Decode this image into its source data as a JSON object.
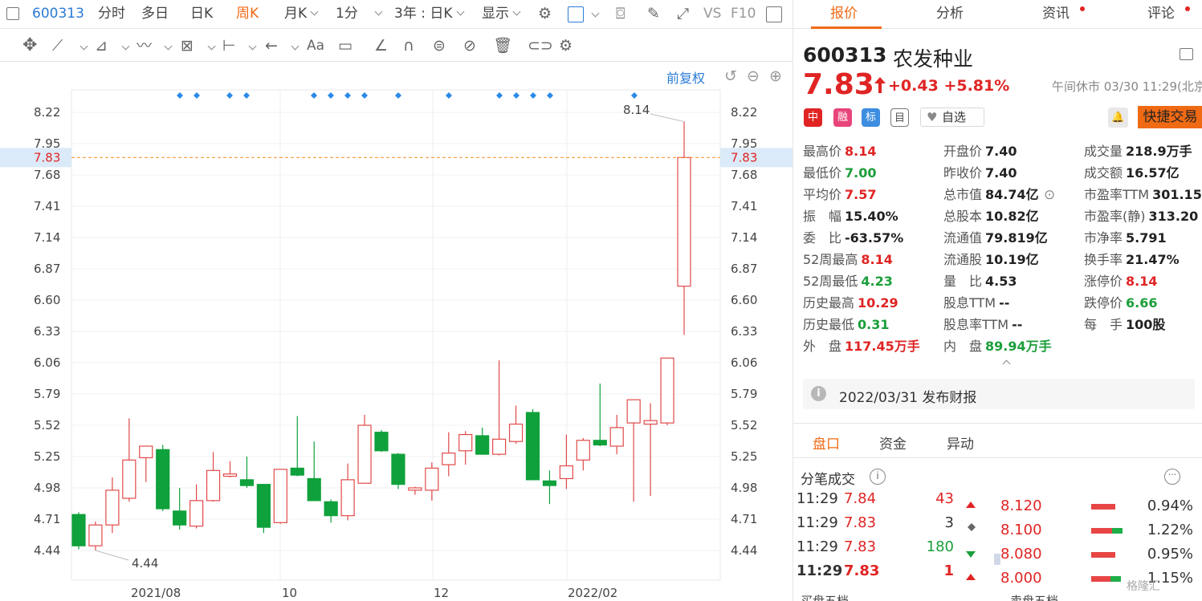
{
  "toolbar": {
    "code": "600313",
    "items": [
      "分时",
      "多日",
      "日K",
      "周K",
      "月K",
      "1分",
      "3年 : 日K",
      "显示"
    ],
    "active": "周K",
    "vs": "VS",
    "f10": "F10"
  },
  "chart": {
    "adjust": "前复权",
    "price_line_label": "7.83",
    "max_label": "8.14",
    "min_label": "4.44"
  },
  "chart_data": {
    "type": "candlestick",
    "y_ticks": [
      "8.22",
      "7.95",
      "7.68",
      "7.41",
      "7.14",
      "6.87",
      "6.60",
      "6.33",
      "6.06",
      "5.79",
      "5.52",
      "5.25",
      "4.98",
      "4.71",
      "4.44"
    ],
    "y_range": [
      4.44,
      8.22
    ],
    "x_labels": [
      "2021/08",
      "10",
      "12",
      "2022/02"
    ],
    "current_price": 7.83,
    "candles": [
      {
        "o": 4.75,
        "h": 4.77,
        "l": 4.45,
        "c": 4.48
      },
      {
        "o": 4.48,
        "h": 4.69,
        "l": 4.44,
        "c": 4.66
      },
      {
        "o": 4.66,
        "h": 5.07,
        "l": 4.59,
        "c": 4.96
      },
      {
        "o": 4.89,
        "h": 5.58,
        "l": 4.86,
        "c": 5.22
      },
      {
        "o": 5.24,
        "h": 5.34,
        "l": 5.03,
        "c": 5.34
      },
      {
        "o": 5.31,
        "h": 5.35,
        "l": 4.78,
        "c": 4.8
      },
      {
        "o": 4.78,
        "h": 4.98,
        "l": 4.62,
        "c": 4.66
      },
      {
        "o": 4.65,
        "h": 5.01,
        "l": 4.63,
        "c": 4.87
      },
      {
        "o": 4.87,
        "h": 5.29,
        "l": 4.86,
        "c": 5.13
      },
      {
        "o": 5.08,
        "h": 5.21,
        "l": 5.07,
        "c": 5.1
      },
      {
        "o": 5.05,
        "h": 5.25,
        "l": 4.98,
        "c": 5.0
      },
      {
        "o": 5.01,
        "h": 5.01,
        "l": 4.59,
        "c": 4.64
      },
      {
        "o": 4.68,
        "h": 5.14,
        "l": 4.67,
        "c": 5.14
      },
      {
        "o": 5.15,
        "h": 5.6,
        "l": 5.08,
        "c": 5.09
      },
      {
        "o": 5.06,
        "h": 5.38,
        "l": 4.87,
        "c": 4.87
      },
      {
        "o": 4.86,
        "h": 4.88,
        "l": 4.68,
        "c": 4.74
      },
      {
        "o": 4.74,
        "h": 5.19,
        "l": 4.7,
        "c": 5.05
      },
      {
        "o": 5.02,
        "h": 5.61,
        "l": 5.02,
        "c": 5.52
      },
      {
        "o": 5.46,
        "h": 5.48,
        "l": 5.29,
        "c": 5.3
      },
      {
        "o": 5.27,
        "h": 5.28,
        "l": 4.97,
        "c": 5.01
      },
      {
        "o": 4.96,
        "h": 4.99,
        "l": 4.92,
        "c": 4.98
      },
      {
        "o": 4.96,
        "h": 5.2,
        "l": 4.87,
        "c": 5.15
      },
      {
        "o": 5.18,
        "h": 5.46,
        "l": 5.08,
        "c": 5.28
      },
      {
        "o": 5.3,
        "h": 5.47,
        "l": 5.18,
        "c": 5.44
      },
      {
        "o": 5.43,
        "h": 5.5,
        "l": 5.27,
        "c": 5.27
      },
      {
        "o": 5.27,
        "h": 6.08,
        "l": 5.26,
        "c": 5.4
      },
      {
        "o": 5.38,
        "h": 5.69,
        "l": 5.36,
        "c": 5.53
      },
      {
        "o": 5.63,
        "h": 5.66,
        "l": 5.05,
        "c": 5.05
      },
      {
        "o": 5.04,
        "h": 5.13,
        "l": 4.84,
        "c": 5.0
      },
      {
        "o": 5.06,
        "h": 5.44,
        "l": 4.97,
        "c": 5.17
      },
      {
        "o": 5.22,
        "h": 5.41,
        "l": 5.13,
        "c": 5.39
      },
      {
        "o": 5.39,
        "h": 5.88,
        "l": 5.34,
        "c": 5.35
      },
      {
        "o": 5.34,
        "h": 5.61,
        "l": 5.27,
        "c": 5.5
      },
      {
        "o": 5.54,
        "h": 5.74,
        "l": 4.86,
        "c": 5.74
      },
      {
        "o": 5.53,
        "h": 5.71,
        "l": 4.91,
        "c": 5.56
      },
      {
        "o": 5.54,
        "h": 6.1,
        "l": 5.52,
        "c": 6.1
      },
      {
        "o": 6.72,
        "h": 8.14,
        "l": 6.3,
        "c": 7.83
      }
    ],
    "markers": 15
  },
  "right": {
    "tabs": [
      "报价",
      "分析",
      "资讯",
      "评论"
    ],
    "active_tab": "报价",
    "code": "600313",
    "name": "农发种业",
    "price": "7.83",
    "change": "+0.43",
    "change_pct": "+5.81%",
    "status": "午间休市 03/30 11:29(北京",
    "badges": [
      "中",
      "融",
      "标",
      "目"
    ],
    "watch": "自选",
    "trade": "快捷交易",
    "quotes": [
      [
        {
          "l": "最高价",
          "v": "8.14",
          "c": "red"
        },
        {
          "l": "开盘价",
          "v": "7.40",
          "c": ""
        },
        {
          "l": "成交量",
          "v": "218.9万手",
          "c": ""
        }
      ],
      [
        {
          "l": "最低价",
          "v": "7.00",
          "c": "green"
        },
        {
          "l": "昨收价",
          "v": "7.40",
          "c": ""
        },
        {
          "l": "成交额",
          "v": "16.57亿",
          "c": ""
        }
      ],
      [
        {
          "l": "平均价",
          "v": "7.57",
          "c": "red"
        },
        {
          "l": "总市值",
          "v": "84.74亿",
          "c": ""
        },
        {
          "l": "市盈率TTM",
          "v": "301.15",
          "c": ""
        }
      ],
      [
        {
          "l": "振　幅",
          "v": "15.40%",
          "c": ""
        },
        {
          "l": "总股本",
          "v": "10.82亿",
          "c": ""
        },
        {
          "l": "市盈率(静)",
          "v": "313.20",
          "c": ""
        }
      ],
      [
        {
          "l": "委　比",
          "v": "-63.57%",
          "c": ""
        },
        {
          "l": "流通值",
          "v": "79.819亿",
          "c": ""
        },
        {
          "l": "市净率",
          "v": "5.791",
          "c": ""
        }
      ],
      [
        {
          "l": "52周最高",
          "v": "8.14",
          "c": "red"
        },
        {
          "l": "流通股",
          "v": "10.19亿",
          "c": ""
        },
        {
          "l": "换手率",
          "v": "21.47%",
          "c": ""
        }
      ],
      [
        {
          "l": "52周最低",
          "v": "4.23",
          "c": "green"
        },
        {
          "l": "量　比",
          "v": "4.53",
          "c": ""
        },
        {
          "l": "涨停价",
          "v": "8.14",
          "c": "red"
        }
      ],
      [
        {
          "l": "历史最高",
          "v": "10.29",
          "c": "red"
        },
        {
          "l": "股息TTM",
          "v": "--",
          "c": ""
        },
        {
          "l": "跌停价",
          "v": "6.66",
          "c": "green"
        }
      ],
      [
        {
          "l": "历史最低",
          "v": "0.31",
          "c": "green"
        },
        {
          "l": "股息率TTM",
          "v": "--",
          "c": ""
        },
        {
          "l": "每　手",
          "v": "100股",
          "c": ""
        }
      ],
      [
        {
          "l": "外　盘",
          "v": "117.45万手",
          "c": "red"
        },
        {
          "l": "内　盘",
          "v": "89.94万手",
          "c": "green"
        },
        {
          "l": "",
          "v": "",
          "c": ""
        }
      ]
    ],
    "finance_notice": "2022/03/31  发布财报",
    "subtabs": [
      "盘口",
      "资金",
      "异动"
    ],
    "active_subtab": "盘口",
    "ticks_title": "分笔成交",
    "ticks": [
      {
        "time": "11:29",
        "price": "7.84",
        "vol": "43",
        "dir": "up"
      },
      {
        "time": "11:29",
        "price": "7.83",
        "vol": "3",
        "dir": "flat"
      },
      {
        "time": "11:29",
        "price": "7.83",
        "vol": "180",
        "dir": "down"
      },
      {
        "time": "11:29",
        "price": "7.83",
        "vol": "1",
        "dir": "up"
      }
    ],
    "depth": [
      {
        "price": "8.120",
        "pct": "0.94%",
        "red": 0.94,
        "green": 0
      },
      {
        "price": "8.100",
        "pct": "1.22%",
        "red": 0.8,
        "green": 0.42
      },
      {
        "price": "8.080",
        "pct": "0.95%",
        "red": 0.95,
        "green": 0
      },
      {
        "price": "8.000",
        "pct": "1.15%",
        "red": 0.75,
        "green": 0.4
      }
    ],
    "bottom_left": "买盘五档",
    "bottom_right": "卖盘五档",
    "logo": "格隆汇"
  }
}
